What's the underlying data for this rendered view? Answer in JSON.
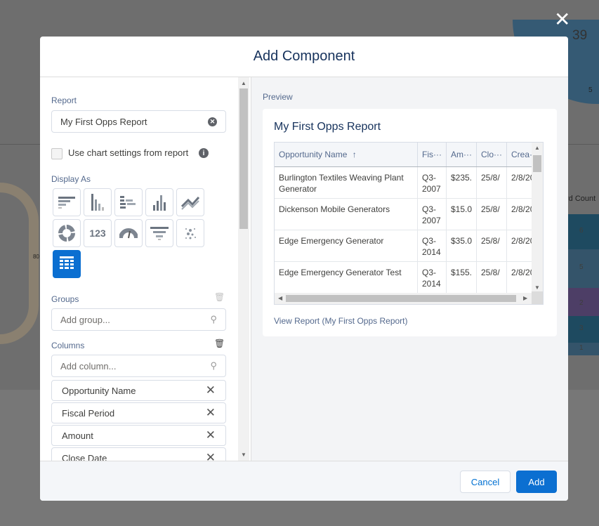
{
  "background": {
    "value_39": "39",
    "value_5": "5",
    "record_count_label": "rd Count",
    "bars": [
      "6",
      "5",
      "2",
      "3",
      "1"
    ],
    "left_value": "80"
  },
  "modal": {
    "title": "Add Component",
    "close_icon": "close-icon"
  },
  "left": {
    "report_label": "Report",
    "report_value": "My First Opps Report",
    "chart_settings_label": "Use chart settings from report",
    "chart_settings_checked": false,
    "display_as_label": "Display As",
    "display_options": [
      "horizontal-bar",
      "vertical-bar",
      "stacked-horizontal-bar",
      "stacked-vertical-bar",
      "line",
      "donut",
      "metric",
      "gauge",
      "funnel",
      "scatter",
      "table"
    ],
    "metric_label": "123",
    "selected_display": "table",
    "groups_label": "Groups",
    "groups_placeholder": "Add group...",
    "columns_label": "Columns",
    "columns_placeholder": "Add column...",
    "columns": [
      "Opportunity Name",
      "Fiscal Period",
      "Amount",
      "Close Date"
    ]
  },
  "preview": {
    "label": "Preview",
    "title": "My First Opps Report",
    "headers": [
      "Opportunity Name",
      "Fis···",
      "Am···",
      "Clo···",
      "Crea···"
    ],
    "sort_indicator": "↑",
    "rows": [
      [
        "Burlington Textiles Weaving Plant Generator",
        "Q3-2007",
        "$235.",
        "25/8/",
        "2/8/20"
      ],
      [
        "Dickenson Mobile Generators",
        "Q3-2007",
        "$15.0",
        "25/8/",
        "2/8/20"
      ],
      [
        "Edge Emergency Generator",
        "Q3-2014",
        "$35.0",
        "25/8/",
        "2/8/20"
      ],
      [
        "Edge Emergency Generator Test",
        "Q3-2014",
        "$155.",
        "25/8/",
        "2/8/20"
      ]
    ],
    "view_report_link": "View Report (My First Opps Report)"
  },
  "footer": {
    "cancel_label": "Cancel",
    "add_label": "Add"
  },
  "colors": {
    "accent": "#0b6fd1",
    "overlay": "#6e6e6e"
  }
}
